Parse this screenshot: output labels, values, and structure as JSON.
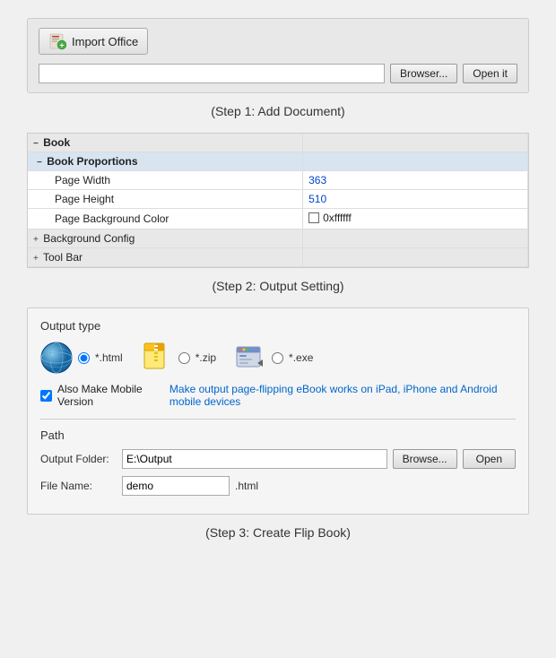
{
  "step1": {
    "import_button_label": "Import Office",
    "file_input_value": "",
    "browser_button": "Browser...",
    "open_button": "Open it",
    "step_label": "(Step 1: Add Document)"
  },
  "step2": {
    "step_label": "(Step 2: Output Setting)",
    "table": {
      "book_label": "Book",
      "book_proportions_label": "Book Proportions",
      "page_width_label": "Page Width",
      "page_width_value": "363",
      "page_height_label": "Page Height",
      "page_height_value": "510",
      "page_bg_color_label": "Page Background Color",
      "page_bg_color_value": "0xffffff",
      "bg_config_label": "Background Config",
      "toolbar_label": "Tool Bar"
    }
  },
  "step3": {
    "step_label": "(Step 3: Create Flip Book)",
    "output_type_label": "Output type",
    "html_option": "*.html",
    "zip_option": "*.zip",
    "exe_option": "*.exe",
    "mobile_checkbox_label": "Also Make Mobile Version",
    "mobile_link_text": "Make output page-flipping eBook works on iPad, iPhone and Android mobile devices",
    "path_label": "Path",
    "output_folder_label": "Output Folder:",
    "output_folder_value": "E:\\Output",
    "browse_button": "Browse...",
    "open_button": "Open",
    "file_name_label": "File Name:",
    "file_name_value": "demo",
    "file_ext": ".html"
  }
}
